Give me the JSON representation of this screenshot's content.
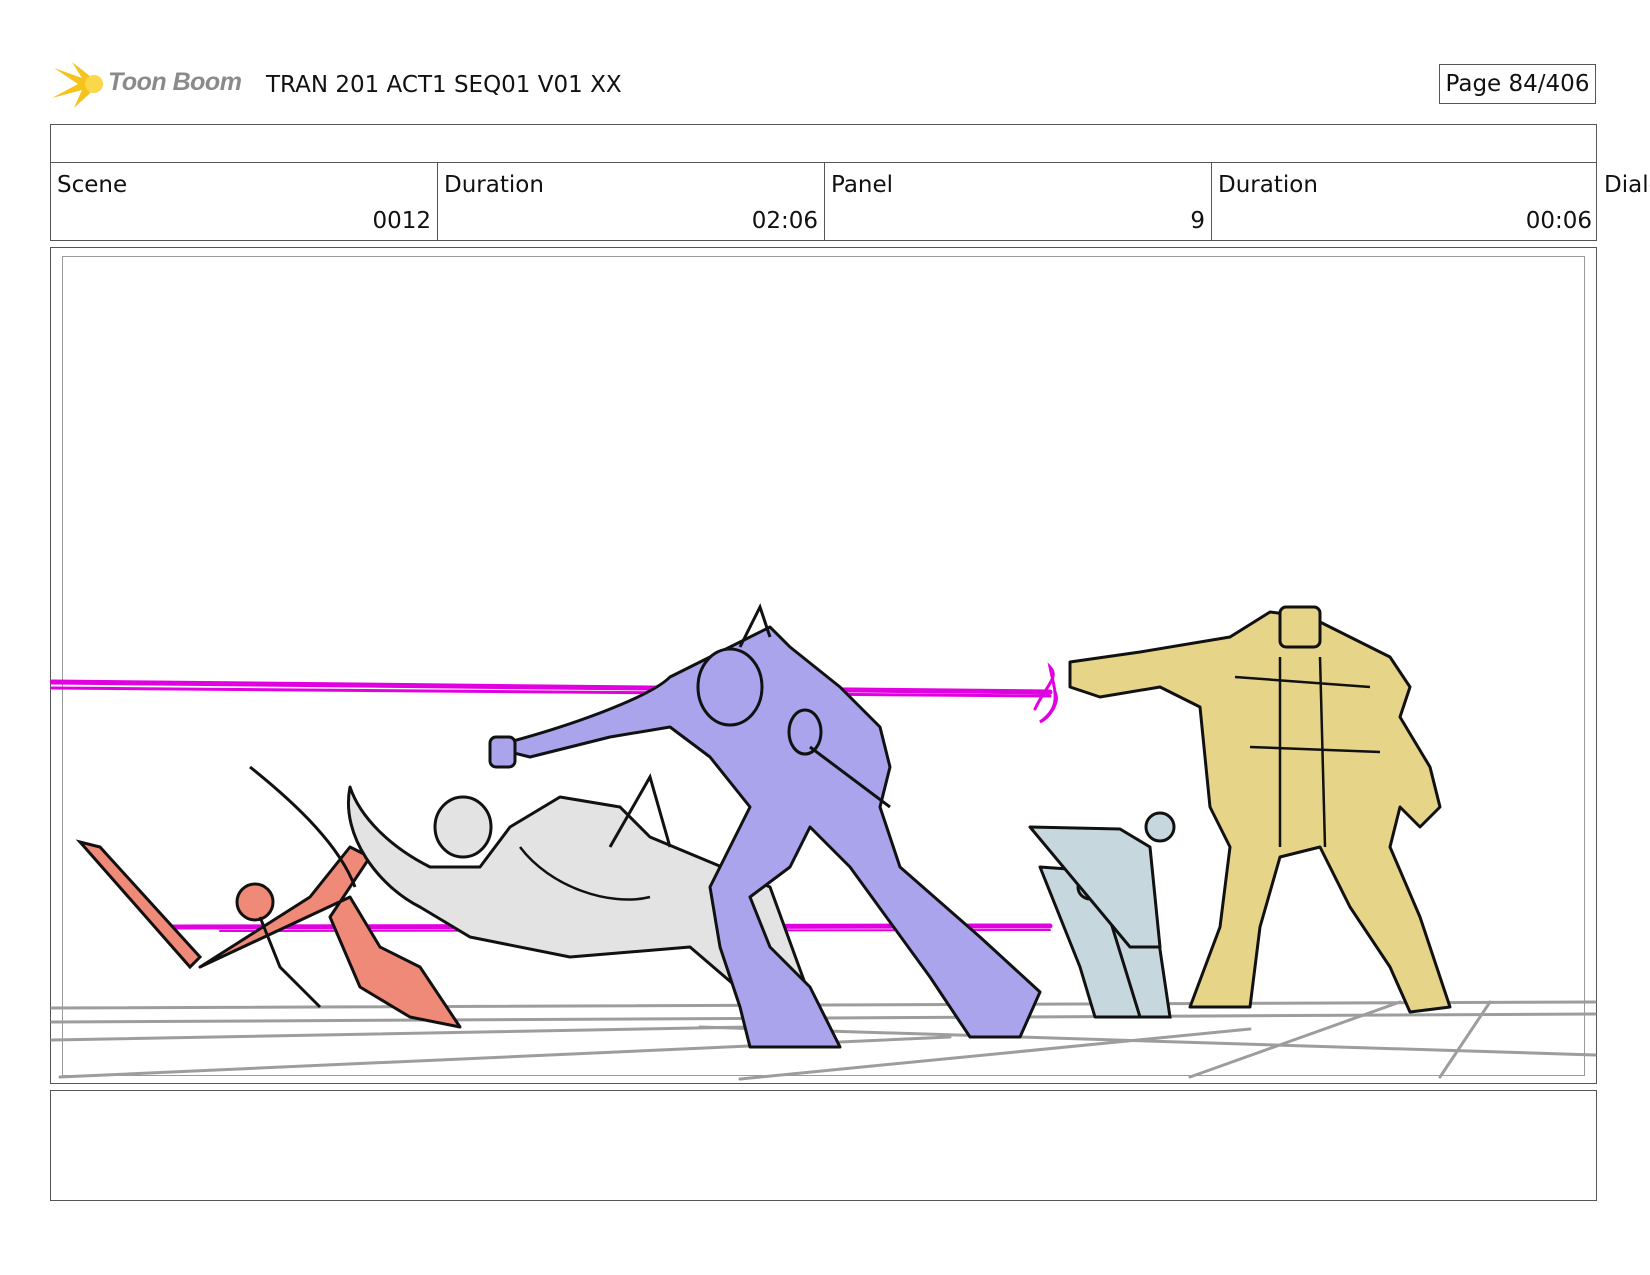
{
  "header": {
    "logo_text": "Toon Boom",
    "title": "TRAN 201 ACT1 SEQ01 V01 XX",
    "page_label": "Page",
    "page_number": "84/406"
  },
  "info": {
    "scene_label": "Scene",
    "scene_value": "0012",
    "scene_duration_label": "Duration",
    "scene_duration_value": "02:06",
    "panel_label": "Panel",
    "panel_value": "9",
    "panel_duration_label": "Duration",
    "panel_duration_value": "00:06",
    "dialog_label": "Dialo"
  },
  "panel": {
    "image": "storyboard-sketch",
    "colors": {
      "laser": "#e000e0",
      "red_figure": "#f08a78",
      "white_figure": "#e3e3e3",
      "purple_figure": "#a9a4ec",
      "soldiers": "#c6d7de",
      "yellow_robot": "#e6d488",
      "floor_lines": "#9d9d9d"
    }
  },
  "notes": {
    "text": ""
  }
}
